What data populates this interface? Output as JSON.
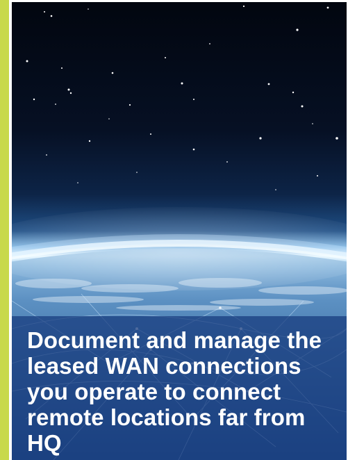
{
  "colors": {
    "accent_bar": "#c8d94a",
    "space": "#030a17",
    "horizon_glow": "#dff4ff",
    "caption_overlay": "#163a7d",
    "caption_text": "#ffffff"
  },
  "hero": {
    "background": "earth-horizon-night-sky-with-network-lines",
    "caption": "Document and manage the leased WAN connections you operate to connect remote locations far from HQ"
  }
}
